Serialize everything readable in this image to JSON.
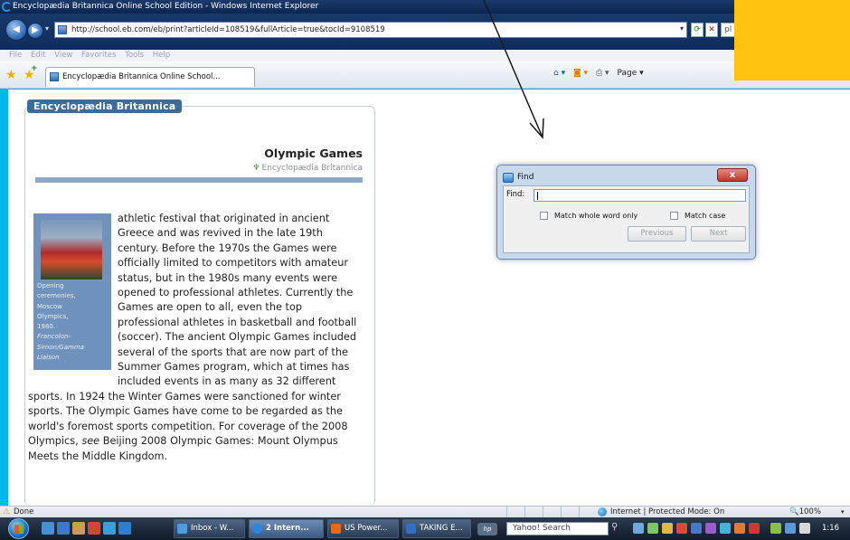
{
  "window": {
    "title": "Encyclopædia Britannica Online School Edition - Windows Internet Explorer",
    "url": "http://school.eb.com/eb/print?articleId=108519&fullArticle=true&tocId=9108519",
    "search_partial": "pl",
    "menu": [
      "File",
      "Edit",
      "View",
      "Favorites",
      "Tools",
      "Help"
    ],
    "tab_title": "Encyclopædia Britannica Online School...",
    "page_menu": "Page ▾",
    "status": "Done",
    "zone": "Internet | Protected Mode: On",
    "zoom": "100%"
  },
  "article": {
    "brand": "Encyclopædia Britannica",
    "title": "Olympic Games",
    "source": "Encyclopædia Britannica",
    "caption_lines": [
      "Opening",
      "ceremonies,",
      "Moscow",
      "Olympics,",
      "1980."
    ],
    "credit_lines": [
      "Francolon-",
      "Simon/Gamma",
      "Liaison"
    ],
    "body_part1": "athletic festival that originated in ancient Greece and was revived in the late 19th century. Before the 1970s the Games were officially limited to competitors with amateur status, but in the 1980s many events were opened to professional athletes. Currently the Games are open to all, even the top professional athletes in basketball and football (soccer). The ancient Olympic Games included several of the sports that are now part of the Summer Games program, which at times has included events in as many as 32 different sports. In 1924 the Winter Games were sanctioned for winter sports. The Olympic Games have come to be regarded as the world's foremost sports competition. For coverage of the 2008 Olympics,",
    "body_see": "see",
    "body_part2": "Beijing 2008 Olympic Games: Mount Olympus Meets the Middle Kingdom."
  },
  "find_dialog": {
    "title": "Find",
    "close": "x",
    "find_label": "Find:",
    "input_value": "",
    "match_whole_word": "Match whole word only",
    "match_case": "Match case",
    "match_whole_word_checked": false,
    "match_case_checked": false,
    "previous": "Previous",
    "next": "Next"
  },
  "taskbar": {
    "tasks": [
      "Inbox - W...",
      "2 Intern...",
      "US Power...",
      "TAKING E..."
    ],
    "yahoo_placeholder": "Yahoo! Search",
    "clock": "1:16 PM"
  },
  "colors": {
    "slide_background": "#00b7eb",
    "gold_box": "#ffc20e",
    "brand_blue": "#3d6c98"
  }
}
